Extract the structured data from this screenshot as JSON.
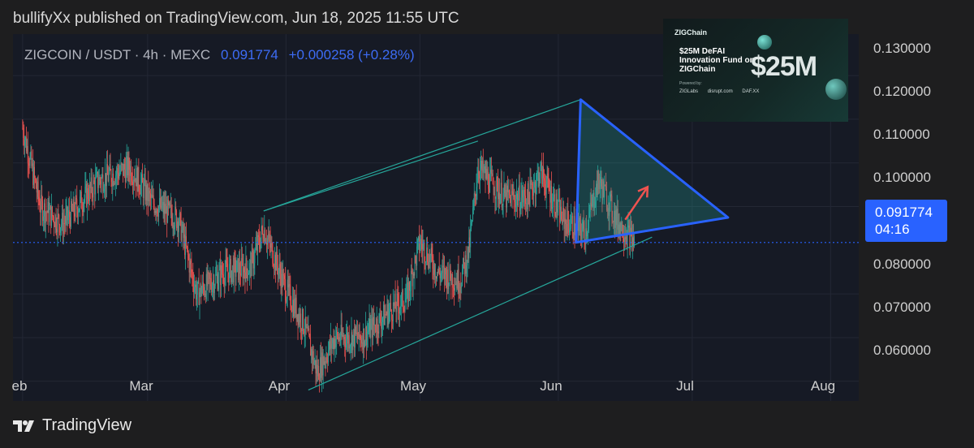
{
  "header": {
    "publisher_text": "bullifyXx published on TradingView.com, Jun 18, 2025 11:55 UTC"
  },
  "symbol": {
    "name": "ZIGCOIN / USDT · 4h · MEXC",
    "last_price": "0.091774",
    "change": "+0.000258 (+0.28%)"
  },
  "price_label": {
    "price": "0.091774",
    "countdown": "04:16"
  },
  "ad": {
    "brand": "ZIGChain",
    "title": "$25M DeFAI Innovation Fund on ZIGChain",
    "amount": "$25M",
    "powered_by": "Powered by:",
    "partners": [
      "ZIGLabs",
      "disrupt.com",
      "DAF.XX"
    ]
  },
  "footer": {
    "logo_text": "TradingView"
  },
  "colors": {
    "background": "#161a25",
    "up": "#26a69a",
    "down": "#ef5350",
    "triangle": "#2962ff",
    "channel": "#26a69a",
    "arrow": "#ef5350",
    "price_line": "#2962ff"
  },
  "chart_data": {
    "type": "candlestick",
    "y_axis_ticks": [
      "0.130000",
      "0.120000",
      "0.110000",
      "0.100000",
      "0.080000",
      "0.070000",
      "0.060000"
    ],
    "x_axis_ticks": [
      "eb",
      "Mar",
      "Apr",
      "May",
      "Jun",
      "Jul",
      "Aug"
    ],
    "ylim": [
      0.0555,
      0.1395
    ],
    "grid": true,
    "current_price": 0.091774,
    "approx_trend": [
      {
        "t": "Feb 01",
        "price": 0.118
      },
      {
        "t": "Feb 05",
        "price": 0.1
      },
      {
        "t": "Feb 10",
        "price": 0.096
      },
      {
        "t": "Feb 18",
        "price": 0.106
      },
      {
        "t": "Feb 25",
        "price": 0.109
      },
      {
        "t": "Mar 02",
        "price": 0.101
      },
      {
        "t": "Mar 08",
        "price": 0.097
      },
      {
        "t": "Mar 12",
        "price": 0.08
      },
      {
        "t": "Mar 18",
        "price": 0.085
      },
      {
        "t": "Mar 24",
        "price": 0.086
      },
      {
        "t": "Mar 27",
        "price": 0.095
      },
      {
        "t": "Apr 01",
        "price": 0.081
      },
      {
        "t": "Apr 05",
        "price": 0.073
      },
      {
        "t": "Apr 08",
        "price": 0.062
      },
      {
        "t": "Apr 12",
        "price": 0.07
      },
      {
        "t": "Apr 18",
        "price": 0.07
      },
      {
        "t": "Apr 24",
        "price": 0.076
      },
      {
        "t": "Apr 28",
        "price": 0.079
      },
      {
        "t": "May 01",
        "price": 0.092
      },
      {
        "t": "May 05",
        "price": 0.085
      },
      {
        "t": "May 10",
        "price": 0.083
      },
      {
        "t": "May 12",
        "price": 0.09
      },
      {
        "t": "May 14",
        "price": 0.109
      },
      {
        "t": "May 20",
        "price": 0.102
      },
      {
        "t": "May 25",
        "price": 0.102
      },
      {
        "t": "May 28",
        "price": 0.108
      },
      {
        "t": "Jun 02",
        "price": 0.097
      },
      {
        "t": "Jun 07",
        "price": 0.094
      },
      {
        "t": "Jun 10",
        "price": 0.106
      },
      {
        "t": "Jun 14",
        "price": 0.097
      },
      {
        "t": "Jun 18",
        "price": 0.0918
      }
    ],
    "drawings": {
      "channel_upper": [
        {
          "t": "Mar 27",
          "price": 0.099
        },
        {
          "t": "Jun 06",
          "price": 0.1245
        }
      ],
      "channel_mid": [
        {
          "t": "Mar 27",
          "price": 0.099
        },
        {
          "t": "May 14",
          "price": 0.115
        }
      ],
      "channel_lower": [
        {
          "t": "Apr 06",
          "price": 0.058
        },
        {
          "t": "Jun 22",
          "price": 0.093
        }
      ],
      "triangle": [
        {
          "t": "Jun 05",
          "price": 0.0918
        },
        {
          "t": "Jun 06",
          "price": 0.1245
        },
        {
          "t": "Jul 09",
          "price": 0.0975
        }
      ],
      "arrow": [
        {
          "t": "Jun 16",
          "price": 0.097
        },
        {
          "t": "Jun 21",
          "price": 0.1045
        }
      ]
    }
  }
}
